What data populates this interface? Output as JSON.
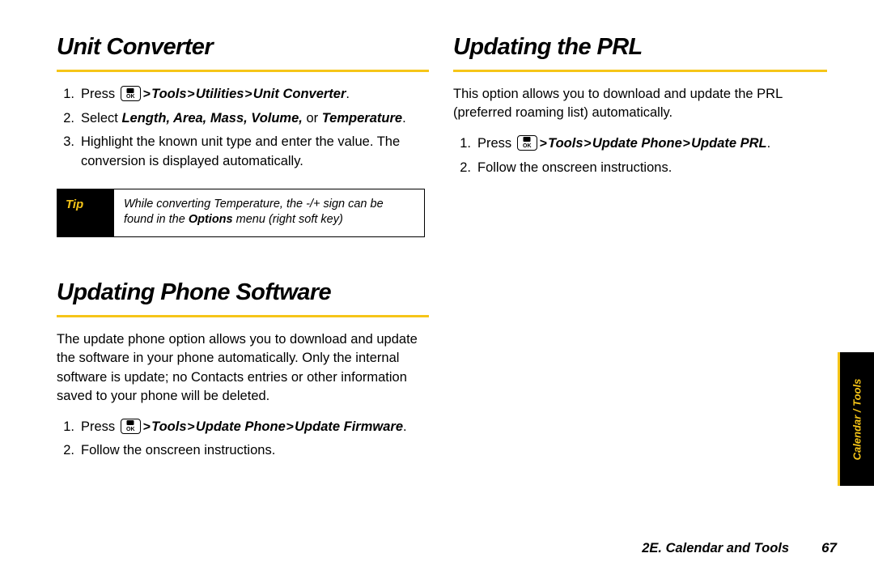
{
  "page": {
    "left_column": {
      "section1": {
        "title": "Unit Converter",
        "steps": [
          {
            "num": "1.",
            "pre": "Press ",
            "key": "OK",
            "gt1": ">",
            "path1": "Tools",
            "gt2": ">",
            "path2": "Utilities",
            "gt3": ">",
            "path3": "Unit Converter",
            "post": "."
          },
          {
            "num": "2.",
            "pre": "Select ",
            "emph": "Length, Area, Mass, Volume,",
            "mid": " or ",
            "emph2": "Temperature",
            "post": "."
          },
          {
            "num": "3.",
            "text": "Highlight the known unit type and enter the value. The conversion is displayed automatically."
          }
        ],
        "tip": {
          "label": "Tip",
          "line1_a": "While converting Temperature, the -/+ sign can be",
          "line2_a": "found in the ",
          "line2_b": "Options",
          "line2_c": " menu (right soft key)"
        }
      },
      "section2": {
        "title": "Updating Phone Software",
        "paragraph": "The update phone option allows you to download and update the software in your phone automatically. Only the internal software is update; no Contacts entries or other information saved to your phone will be deleted.",
        "steps": [
          {
            "num": "1.",
            "pre": "Press ",
            "key": "OK",
            "gt1": ">",
            "path1": "Tools",
            "gt2": ">",
            "path2": "Update Phone",
            "gt3": ">",
            "path3": "Update Firmware",
            "post": "."
          },
          {
            "num": "2.",
            "text": "Follow the onscreen instructions."
          }
        ]
      }
    },
    "right_column": {
      "section1": {
        "title": "Updating the PRL",
        "paragraph": "This option allows you to download and update the PRL (preferred roaming list) automatically.",
        "steps": [
          {
            "num": "1.",
            "pre": "Press ",
            "key": "OK",
            "gt1": ">",
            "path1": "Tools",
            "gt2": ">",
            "path2": "Update Phone",
            "gt3": ">",
            "path3": "Update PRL",
            "post": "."
          },
          {
            "num": "2.",
            "text": "Follow the onscreen instructions."
          }
        ]
      }
    },
    "side_tab": {
      "label": "Calendar / Tools"
    },
    "footer": {
      "chapter": "2E. Calendar and Tools",
      "page_number": "67"
    },
    "colors": {
      "accent": "#f6c518",
      "text": "#000000",
      "background": "#ffffff"
    }
  }
}
